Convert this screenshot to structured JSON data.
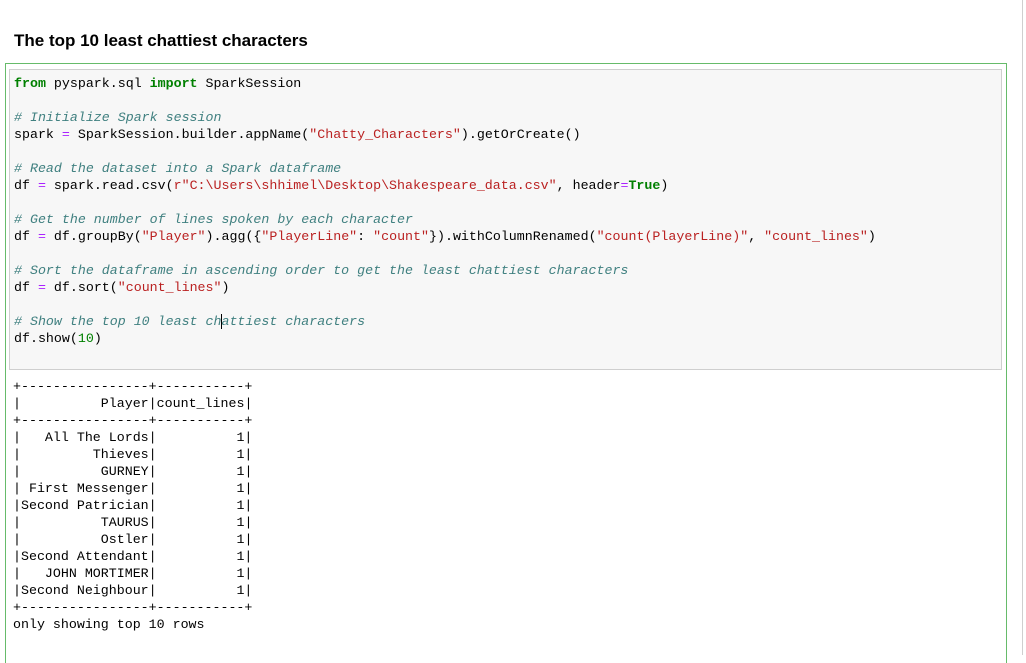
{
  "heading": "The top 10 least chattiest characters",
  "code_lines": [
    [
      {
        "t": "from",
        "c": "kw"
      },
      {
        "t": " pyspark.sql "
      },
      {
        "t": "import",
        "c": "kw"
      },
      {
        "t": " SparkSession"
      }
    ],
    [],
    [
      {
        "t": "# Initialize Spark session",
        "c": "cm"
      }
    ],
    [
      {
        "t": "spark "
      },
      {
        "t": "=",
        "c": "op"
      },
      {
        "t": " SparkSession.builder.appName("
      },
      {
        "t": "\"Chatty_Characters\"",
        "c": "st"
      },
      {
        "t": ").getOrCreate()"
      }
    ],
    [],
    [
      {
        "t": "# Read the dataset into a Spark dataframe",
        "c": "cm"
      }
    ],
    [
      {
        "t": "df "
      },
      {
        "t": "=",
        "c": "op"
      },
      {
        "t": " spark.read.csv("
      },
      {
        "t": "r\"C:\\Users\\shhimel\\Desktop\\Shakespeare_data.csv\"",
        "c": "st"
      },
      {
        "t": ", header"
      },
      {
        "t": "=",
        "c": "op"
      },
      {
        "t": "True",
        "c": "kw"
      },
      {
        "t": ")"
      }
    ],
    [],
    [
      {
        "t": "# Get the number of lines spoken by each character",
        "c": "cm"
      }
    ],
    [
      {
        "t": "df "
      },
      {
        "t": "=",
        "c": "op"
      },
      {
        "t": " df.groupBy("
      },
      {
        "t": "\"Player\"",
        "c": "st"
      },
      {
        "t": ").agg({"
      },
      {
        "t": "\"PlayerLine\"",
        "c": "st"
      },
      {
        "t": ": "
      },
      {
        "t": "\"count\"",
        "c": "st"
      },
      {
        "t": "}).withColumnRenamed("
      },
      {
        "t": "\"count(PlayerLine)\"",
        "c": "st"
      },
      {
        "t": ", "
      },
      {
        "t": "\"count_lines\"",
        "c": "st"
      },
      {
        "t": ")"
      }
    ],
    [],
    [
      {
        "t": "# Sort the dataframe in ascending order to get the least chattiest characters",
        "c": "cm"
      }
    ],
    [
      {
        "t": "df "
      },
      {
        "t": "=",
        "c": "op"
      },
      {
        "t": " df.sort("
      },
      {
        "t": "\"count_lines\"",
        "c": "st"
      },
      {
        "t": ")"
      }
    ],
    [],
    [
      {
        "t": "# Show the top 10 least ch",
        "c": "cm"
      },
      {
        "t": "attiest characters",
        "c": "cm"
      }
    ],
    [
      {
        "t": "df.show("
      },
      {
        "t": "10",
        "c": "nu"
      },
      {
        "t": ")"
      }
    ]
  ],
  "output": {
    "columns": [
      "Player",
      "count_lines"
    ],
    "rows": [
      [
        "All The Lords",
        "1"
      ],
      [
        "Thieves",
        "1"
      ],
      [
        "GURNEY",
        "1"
      ],
      [
        "First Messenger",
        "1"
      ],
      [
        "Second Patrician",
        "1"
      ],
      [
        "TAURUS",
        "1"
      ],
      [
        "Ostler",
        "1"
      ],
      [
        "Second Attendant",
        "1"
      ],
      [
        "JOHN MORTIMER",
        "1"
      ],
      [
        "Second Neighbour",
        "1"
      ]
    ],
    "footer": "only showing top 10 rows"
  }
}
